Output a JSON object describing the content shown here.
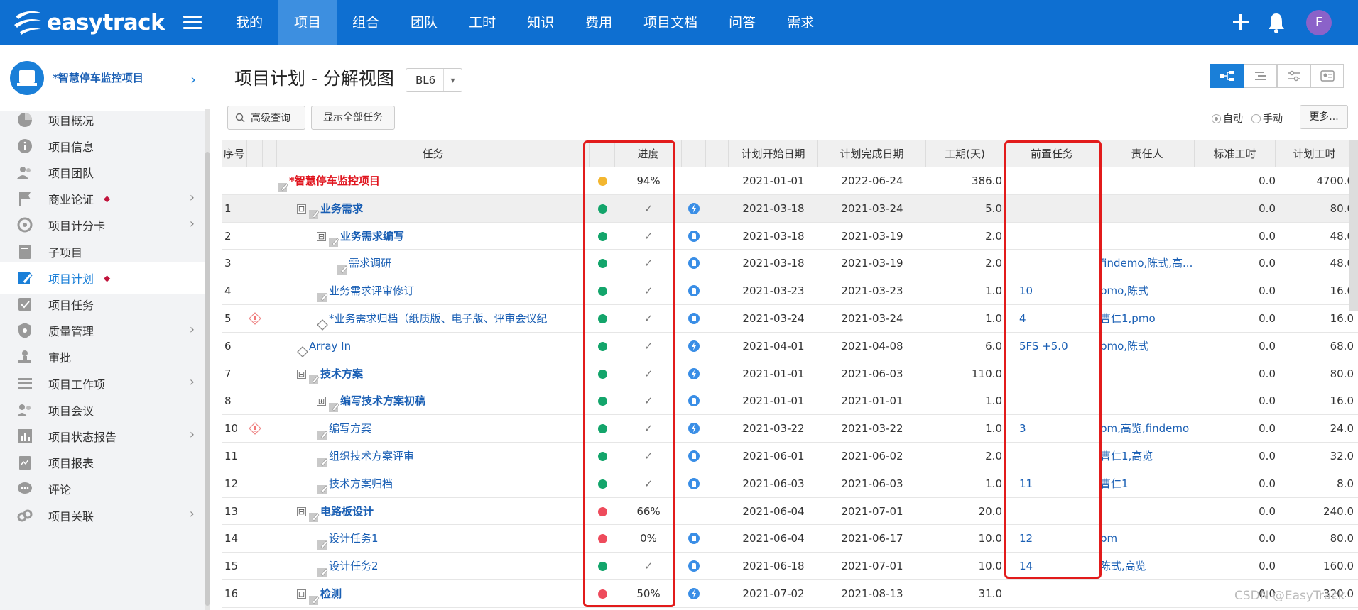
{
  "brand": {
    "name": "easytrack"
  },
  "topnav": [
    "我的",
    "项目",
    "组合",
    "团队",
    "工时",
    "知识",
    "费用",
    "项目文档",
    "问答",
    "需求"
  ],
  "user": {
    "initial": "F"
  },
  "project": {
    "name": "*智慧停车监控项目"
  },
  "sidebar": [
    {
      "label": "项目概况",
      "icon": "pie-chart-icon"
    },
    {
      "label": "项目信息",
      "icon": "info-icon"
    },
    {
      "label": "项目团队",
      "icon": "team-icon"
    },
    {
      "label": "商业论证",
      "icon": "flag-icon",
      "dot": "◆",
      "chev": true
    },
    {
      "label": "项目计分卡",
      "icon": "target-icon",
      "chev": true
    },
    {
      "label": "子项目",
      "icon": "subproject-icon"
    },
    {
      "label": "项目计划",
      "icon": "plan-edit-icon",
      "dot": "◆",
      "active": true
    },
    {
      "label": "项目任务",
      "icon": "task-check-icon"
    },
    {
      "label": "质量管理",
      "icon": "shield-icon",
      "chev": true
    },
    {
      "label": "审批",
      "icon": "approve-icon"
    },
    {
      "label": "项目工作项",
      "icon": "list-icon",
      "chev": true
    },
    {
      "label": "项目会议",
      "icon": "meeting-icon"
    },
    {
      "label": "项目状态报告",
      "icon": "report-bar-icon",
      "chev": true
    },
    {
      "label": "项目报表",
      "icon": "clipboard-icon"
    },
    {
      "label": "评论",
      "icon": "comment-icon"
    },
    {
      "label": "项目关联",
      "icon": "link-icon",
      "chev": true
    }
  ],
  "page": {
    "title": "项目计划 - 分解视图",
    "baseline": "BL6"
  },
  "toolbar": {
    "search": "高级查询",
    "show_all": "显示全部任务",
    "auto": "自动",
    "manual": "手动",
    "more": "更多..."
  },
  "columns": {
    "no": "序号",
    "task": "任务",
    "progress": "进度",
    "start": "计划开始日期",
    "end": "计划完成日期",
    "duration": "工期(天)",
    "pred": "前置任务",
    "owner": "责任人",
    "std": "标准工时",
    "plan": "计划工时"
  },
  "rows": [
    {
      "no": "",
      "task": "*智慧停车监控项目",
      "level": 0,
      "type": "root",
      "status": "yellow",
      "progress": "94%",
      "icon": "",
      "start": "2021-01-01",
      "end": "2022-06-24",
      "duration": "386.0",
      "pred": "",
      "owner": "",
      "std": "0.0",
      "plan": "4700.0"
    },
    {
      "no": "1",
      "task": "业务需求",
      "level": 1,
      "type": "group",
      "toggle": "⊟",
      "status": "green",
      "progress": "✓",
      "icon": "auto",
      "start": "2021-03-18",
      "end": "2021-03-24",
      "duration": "5.0",
      "pred": "",
      "owner": "",
      "std": "0.0",
      "plan": "80.0"
    },
    {
      "no": "2",
      "task": "业务需求编写",
      "level": 2,
      "type": "group",
      "toggle": "⊟",
      "status": "green",
      "progress": "✓",
      "icon": "manual",
      "start": "2021-03-18",
      "end": "2021-03-19",
      "duration": "2.0",
      "pred": "",
      "owner": "",
      "std": "0.0",
      "plan": "48.0"
    },
    {
      "no": "3",
      "task": "需求调研",
      "level": 3,
      "type": "task",
      "status": "green",
      "progress": "✓",
      "icon": "manual",
      "start": "2021-03-18",
      "end": "2021-03-19",
      "duration": "2.0",
      "pred": "",
      "owner": "findemo,陈式,高...",
      "std": "0.0",
      "plan": "48.0"
    },
    {
      "no": "4",
      "task": "业务需求评审修订",
      "level": 2,
      "type": "task",
      "status": "green",
      "progress": "✓",
      "icon": "manual",
      "start": "2021-03-23",
      "end": "2021-03-23",
      "duration": "1.0",
      "pred": "10",
      "owner": "pmo,陈式",
      "std": "0.0",
      "plan": "16.0"
    },
    {
      "no": "5",
      "task": "*业务需求归档（纸质版、电子版、评审会议纪",
      "level": 2,
      "type": "milestone",
      "warn": true,
      "status": "green",
      "progress": "✓",
      "icon": "manual",
      "start": "2021-03-24",
      "end": "2021-03-24",
      "duration": "1.0",
      "pred": "4",
      "owner": "曹仁1,pmo",
      "std": "0.0",
      "plan": "16.0"
    },
    {
      "no": "6",
      "task": "Array In",
      "level": 1,
      "type": "milestone",
      "status": "green",
      "progress": "✓",
      "icon": "auto",
      "start": "2021-04-01",
      "end": "2021-04-08",
      "duration": "6.0",
      "pred": "5FS +5.0",
      "owner": "pmo,陈式",
      "std": "0.0",
      "plan": "68.0"
    },
    {
      "no": "7",
      "task": "技术方案",
      "level": 1,
      "type": "group",
      "toggle": "⊟",
      "status": "green",
      "progress": "✓",
      "icon": "auto",
      "start": "2021-01-01",
      "end": "2021-06-03",
      "duration": "110.0",
      "pred": "",
      "owner": "",
      "std": "0.0",
      "plan": "80.0"
    },
    {
      "no": "8",
      "task": "编写技术方案初稿",
      "level": 2,
      "type": "group",
      "toggle": "⊞",
      "status": "green",
      "progress": "✓",
      "icon": "manual",
      "start": "2021-01-01",
      "end": "2021-01-01",
      "duration": "1.0",
      "pred": "",
      "owner": "",
      "std": "0.0",
      "plan": "16.0"
    },
    {
      "no": "10",
      "task": "编写方案",
      "level": 2,
      "type": "task",
      "warn": true,
      "status": "green",
      "progress": "✓",
      "icon": "auto",
      "start": "2021-03-22",
      "end": "2021-03-22",
      "duration": "1.0",
      "pred": "3",
      "owner": "pm,高览,findemo",
      "std": "0.0",
      "plan": "24.0"
    },
    {
      "no": "11",
      "task": "组织技术方案评审",
      "level": 2,
      "type": "task",
      "status": "green",
      "progress": "✓",
      "icon": "manual",
      "start": "2021-06-01",
      "end": "2021-06-02",
      "duration": "2.0",
      "pred": "",
      "owner": "曹仁1,高览",
      "std": "0.0",
      "plan": "32.0"
    },
    {
      "no": "12",
      "task": "技术方案归档",
      "level": 2,
      "type": "task",
      "status": "green",
      "progress": "✓",
      "icon": "manual",
      "start": "2021-06-03",
      "end": "2021-06-03",
      "duration": "1.0",
      "pred": "11",
      "owner": "曹仁1",
      "std": "0.0",
      "plan": "8.0"
    },
    {
      "no": "13",
      "task": "电路板设计",
      "level": 1,
      "type": "group",
      "toggle": "⊟",
      "status": "red",
      "progress": "66%",
      "icon": "",
      "start": "2021-06-04",
      "end": "2021-07-01",
      "duration": "20.0",
      "pred": "",
      "owner": "",
      "std": "0.0",
      "plan": "240.0"
    },
    {
      "no": "14",
      "task": "设计任务1",
      "level": 2,
      "type": "task",
      "status": "red",
      "progress": "0%",
      "icon": "manual",
      "start": "2021-06-04",
      "end": "2021-06-17",
      "duration": "10.0",
      "pred": "12",
      "owner": "pm",
      "std": "0.0",
      "plan": "80.0"
    },
    {
      "no": "15",
      "task": "设计任务2",
      "level": 2,
      "type": "task",
      "status": "green",
      "progress": "✓",
      "icon": "manual",
      "start": "2021-06-18",
      "end": "2021-07-01",
      "duration": "10.0",
      "pred": "14",
      "owner": "陈式,高览",
      "std": "0.0",
      "plan": "160.0"
    },
    {
      "no": "16",
      "task": "检测",
      "level": 1,
      "type": "group",
      "toggle": "⊟",
      "status": "red",
      "progress": "50%",
      "icon": "auto",
      "start": "2021-07-02",
      "end": "2021-08-13",
      "duration": "31.0",
      "pred": "",
      "owner": "",
      "std": "0.0",
      "plan": "320.0"
    }
  ],
  "colors": {
    "green": "#13a56b",
    "red": "#ee4b5c",
    "yellow": "#f3b62f",
    "brand": "#0e6fd1",
    "highlight": "#e21b1b"
  },
  "watermark": "CSDN @EasyTrack"
}
